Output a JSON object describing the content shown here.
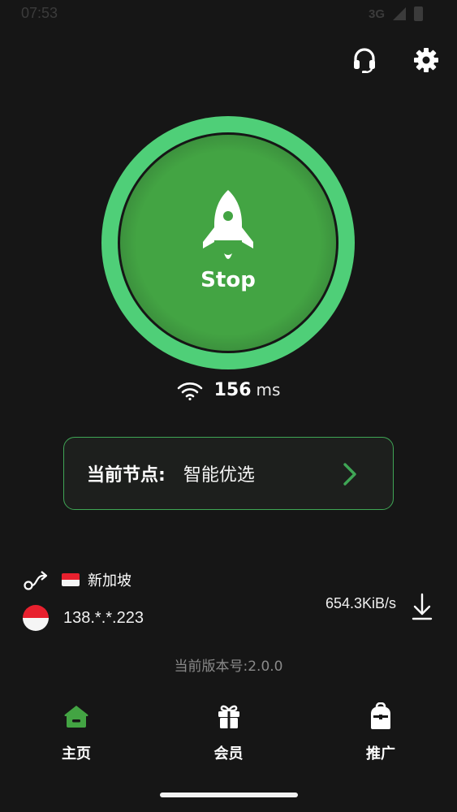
{
  "status_bar": {
    "time": "07:53",
    "network": "3G"
  },
  "header": {
    "support_icon": "headset-icon",
    "settings_icon": "gear-icon"
  },
  "connect": {
    "label": "Stop",
    "icon": "rocket-icon",
    "ring_color": "#4fcf78",
    "core_color": "#43a443"
  },
  "latency": {
    "value": "156",
    "unit": "ms",
    "icon": "wifi-icon"
  },
  "node": {
    "label": "当前节点:",
    "value": "智能优选",
    "arrow_icon": "chevron-right-icon",
    "border_color": "#3fa655"
  },
  "route": {
    "icon": "route-icon",
    "flag_emoji": "🇸🇬",
    "country": "新加坡"
  },
  "ip": {
    "address": "138.*.*.223",
    "flag_icon": "singapore-flag-icon"
  },
  "traffic": {
    "speed": "654.3KiB/s",
    "icon": "download-icon"
  },
  "version": "当前版本号:2.0.0",
  "bottom_nav": {
    "items": [
      {
        "label": "主页",
        "icon": "home-icon",
        "active": true
      },
      {
        "label": "会员",
        "icon": "gift-icon",
        "active": false
      },
      {
        "label": "推广",
        "icon": "backpack-icon",
        "active": false
      }
    ],
    "active_color": "#43a443"
  }
}
